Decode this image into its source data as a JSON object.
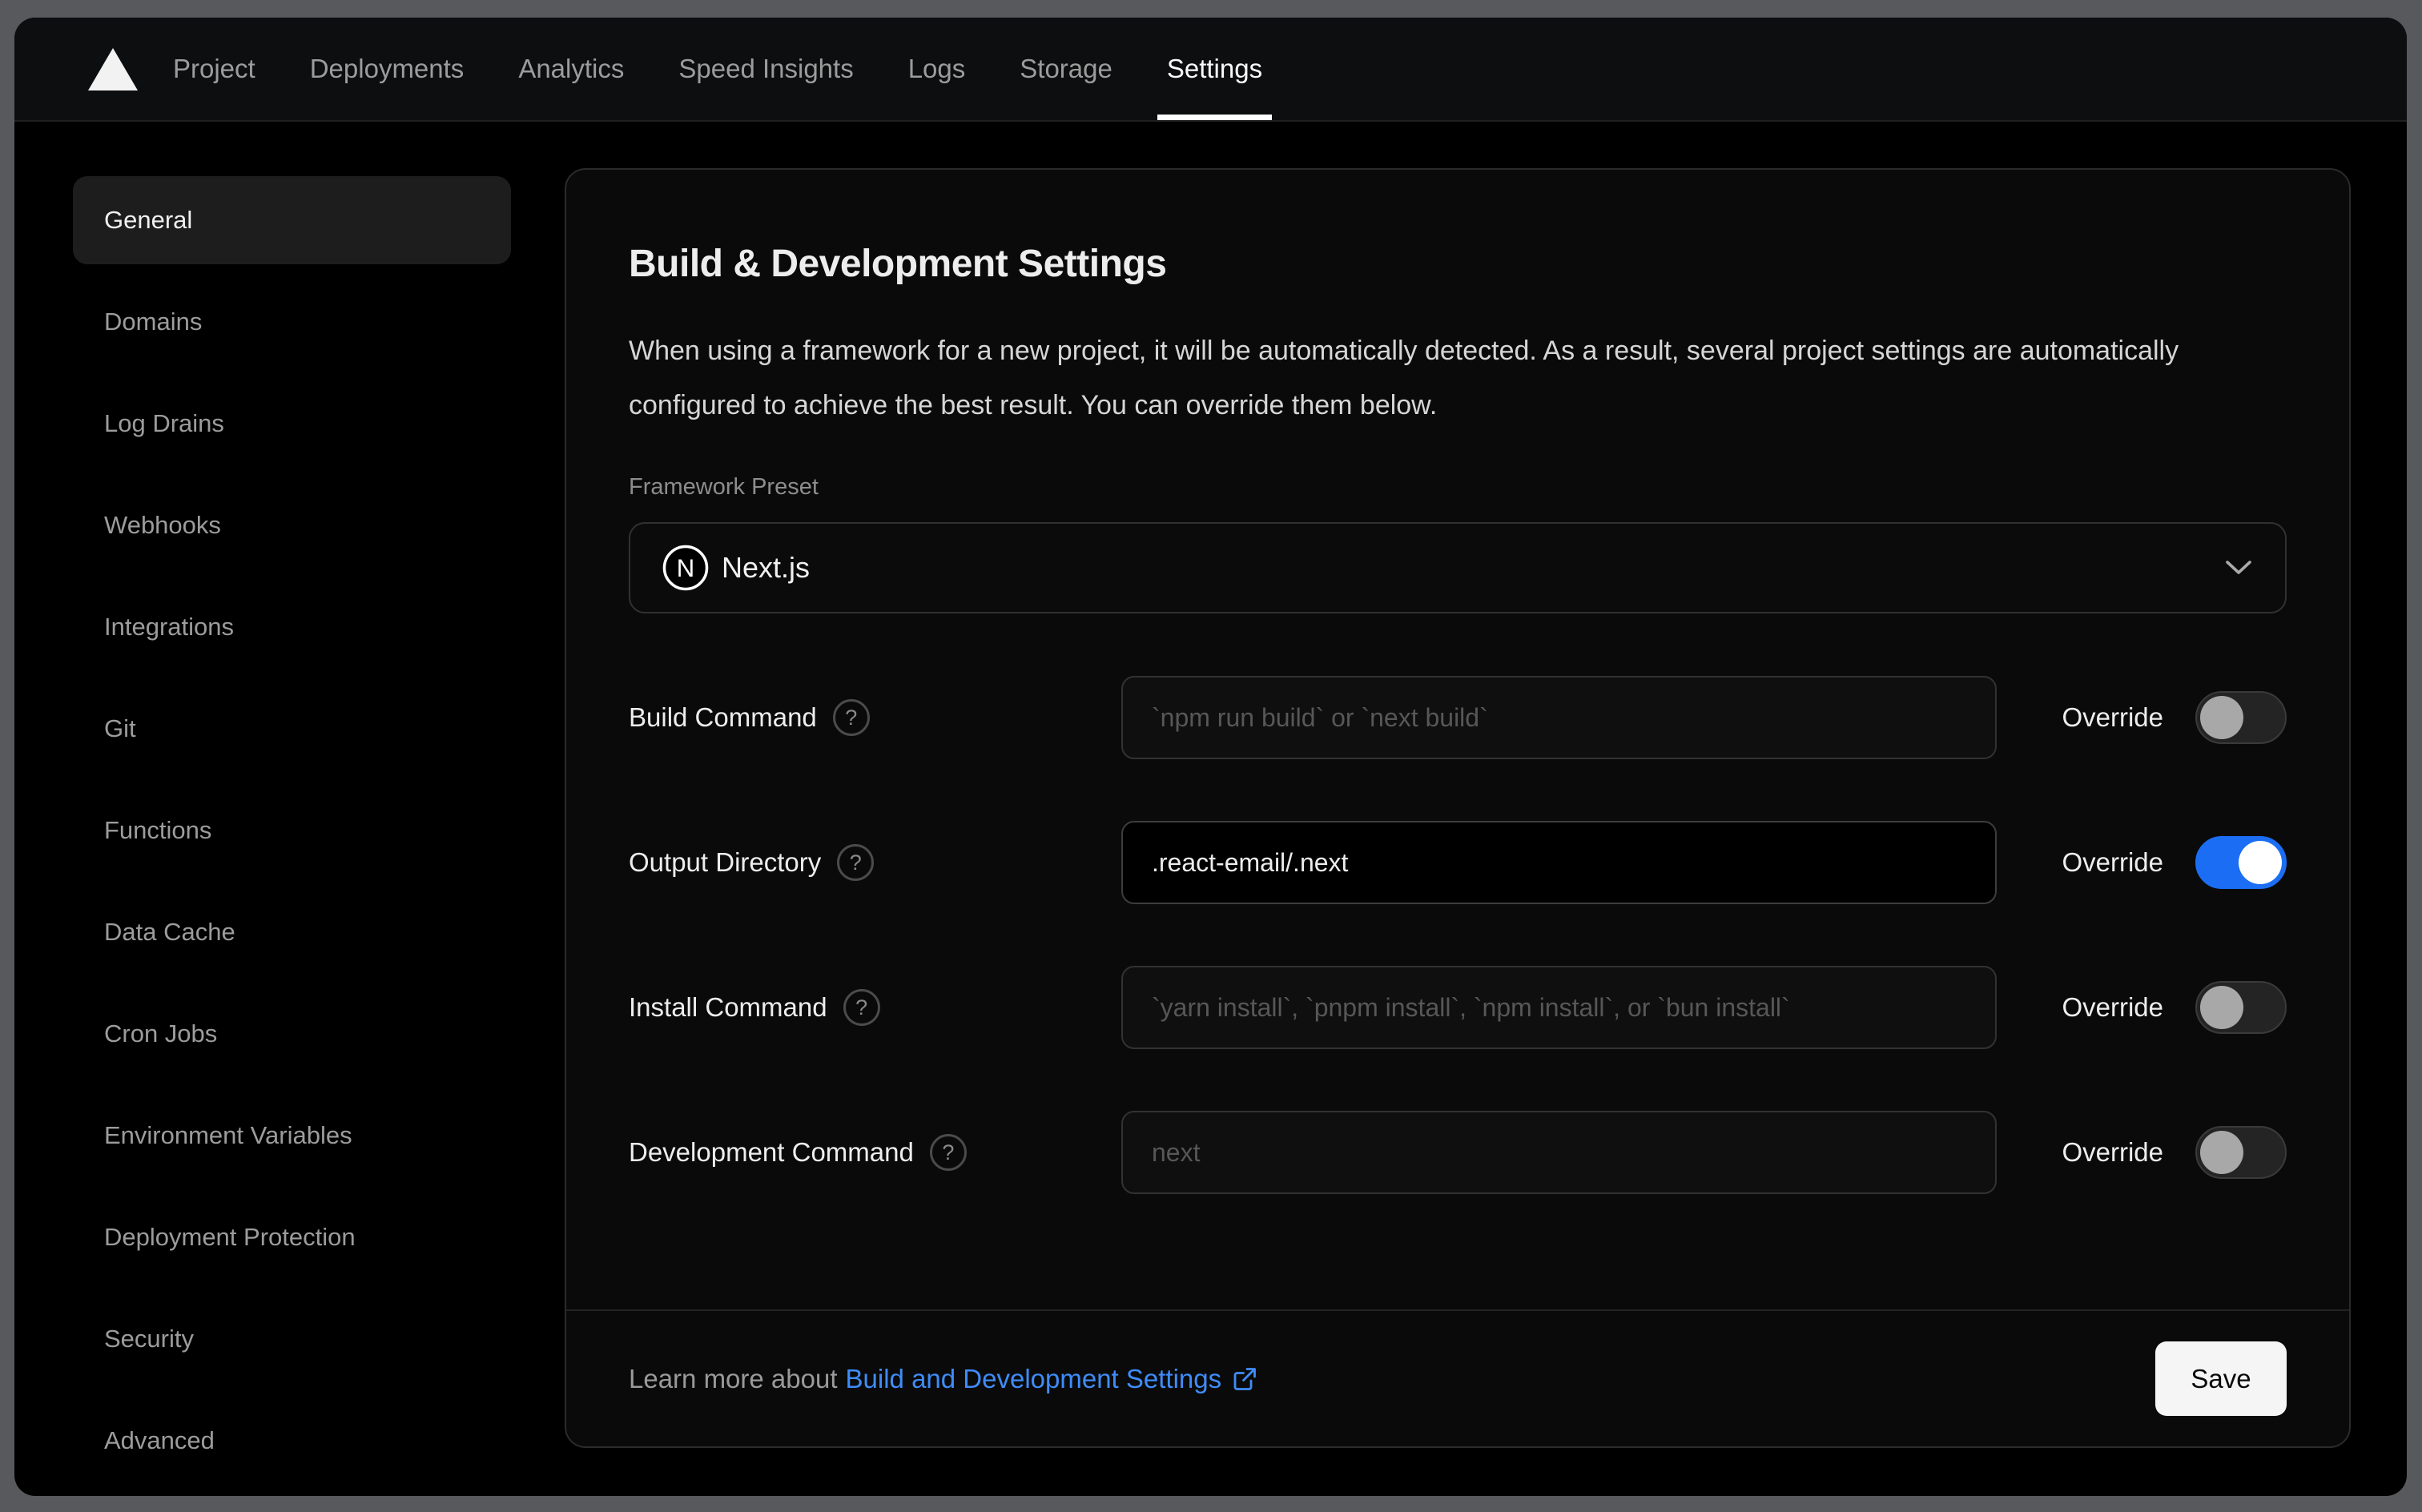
{
  "nav": {
    "logo_icon": "vercel-triangle-icon",
    "tabs": [
      "Project",
      "Deployments",
      "Analytics",
      "Speed Insights",
      "Logs",
      "Storage",
      "Settings"
    ],
    "active_tab": "Settings"
  },
  "sidebar": {
    "items": [
      "General",
      "Domains",
      "Log Drains",
      "Webhooks",
      "Integrations",
      "Git",
      "Functions",
      "Data Cache",
      "Cron Jobs",
      "Environment Variables",
      "Deployment Protection",
      "Security",
      "Advanced"
    ],
    "active_item": "General"
  },
  "main": {
    "title": "Build & Development Settings",
    "description": "When using a framework for a new project, it will be automatically detected. As a result, several project settings are automatically configured to achieve the best result. You can override them below.",
    "framework": {
      "label": "Framework Preset",
      "value": "Next.js",
      "icon": "nextjs-logo-icon",
      "chevron_icon": "chevron-down-icon"
    },
    "rows": [
      {
        "label": "Build Command",
        "placeholder": "`npm run build` or `next build`",
        "value": "",
        "override_label": "Override",
        "override_on": false
      },
      {
        "label": "Output Directory",
        "placeholder": "",
        "value": ".react-email/.next",
        "override_label": "Override",
        "override_on": true
      },
      {
        "label": "Install Command",
        "placeholder": "`yarn install`, `pnpm install`, `npm install`, or `bun install`",
        "value": "",
        "override_label": "Override",
        "override_on": false
      },
      {
        "label": "Development Command",
        "placeholder": "next",
        "value": "",
        "override_label": "Override",
        "override_on": false
      }
    ]
  },
  "footer": {
    "learn_prefix": "Learn more about",
    "link_label": "Build and Development Settings",
    "external_icon": "external-link-icon",
    "save_label": "Save"
  },
  "colors": {
    "chrome": "#57595c",
    "accent_blue_toggle": "#1b6ef3",
    "link_blue": "#3f8cf8",
    "card_bg": "#0a0a0a",
    "save_bg": "#f5f5f5"
  }
}
